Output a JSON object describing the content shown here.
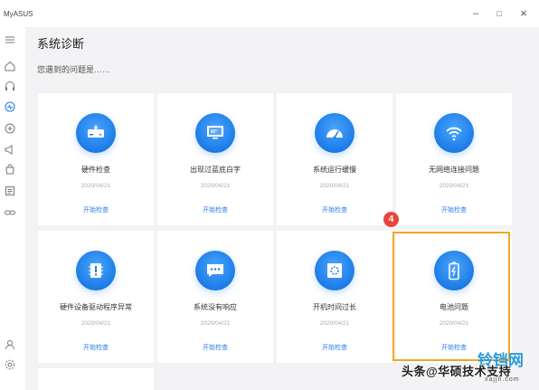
{
  "app": {
    "name": "MyASUS"
  },
  "window": {
    "minimize": "–",
    "maximize": "□",
    "close": "×"
  },
  "header": {
    "title": "系统诊断",
    "subtitle": "您遇到的问题是……"
  },
  "sidebar": {
    "items": [
      {
        "name": "menu",
        "icon": "hamburger-icon"
      },
      {
        "name": "home",
        "icon": "home-icon"
      },
      {
        "name": "support",
        "icon": "headset-icon"
      },
      {
        "name": "diagnosis",
        "icon": "diagnosis-icon"
      },
      {
        "name": "link",
        "icon": "link-icon"
      },
      {
        "name": "promotion",
        "icon": "megaphone-icon"
      },
      {
        "name": "store",
        "icon": "bag-icon"
      },
      {
        "name": "news",
        "icon": "news-icon"
      },
      {
        "name": "sync",
        "icon": "link-chain-icon"
      },
      {
        "name": "account",
        "icon": "user-icon"
      },
      {
        "name": "settings",
        "icon": "gear-icon"
      }
    ]
  },
  "cards": [
    {
      "title": "硬件检查",
      "date": "2020/04/21",
      "action": "开始检查",
      "icon": "drive-icon"
    },
    {
      "title": "出现过蓝底白字",
      "date": "2020/04/21",
      "action": "开始检查",
      "icon": "monitor-icon"
    },
    {
      "title": "系统运行缓慢",
      "date": "2020/04/21",
      "action": "开始检查",
      "icon": "gauge-icon"
    },
    {
      "title": "无网络连接问题",
      "date": "2020/04/21",
      "action": "开始检查",
      "icon": "wifi-icon"
    },
    {
      "title": "硬件设备驱动程序异常",
      "date": "2020/04/21",
      "action": "开始检查",
      "icon": "driver-alert-icon"
    },
    {
      "title": "系统没有响应",
      "date": "2020/04/21",
      "action": "开始检查",
      "icon": "chat-dots-icon"
    },
    {
      "title": "开机时间过长",
      "date": "2020/04/21",
      "action": "开始检查",
      "icon": "boot-screen-icon"
    },
    {
      "title": "电池问题",
      "date": "2020/04/21",
      "action": "开始检查",
      "icon": "battery-icon"
    }
  ],
  "annotation": {
    "step": "4",
    "color": "#f4a623",
    "badge_color": "#e8453c"
  },
  "watermark": {
    "text": "头条@华硕技术支持",
    "logo": "铃铛网",
    "url": "xajjn.com"
  },
  "colors": {
    "accent": "#2b7de9",
    "icon_bg": "#1c7be6"
  }
}
